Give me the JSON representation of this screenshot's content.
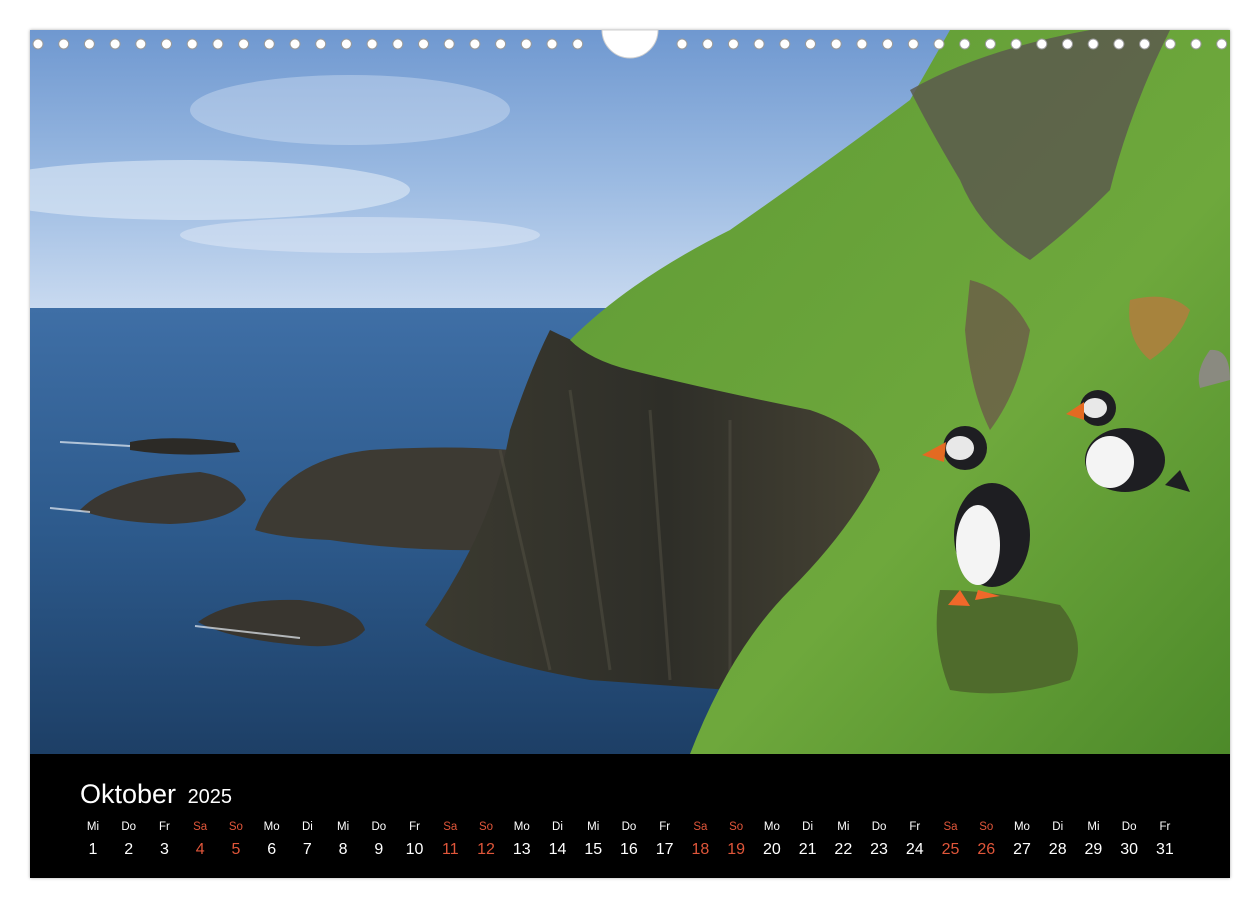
{
  "calendar": {
    "month": "Oktober",
    "year": "2025",
    "weekend_color": "#e0563a",
    "days": [
      {
        "wd": "Mi",
        "n": "1"
      },
      {
        "wd": "Do",
        "n": "2"
      },
      {
        "wd": "Fr",
        "n": "3"
      },
      {
        "wd": "Sa",
        "n": "4",
        "we": true
      },
      {
        "wd": "So",
        "n": "5",
        "we": true
      },
      {
        "wd": "Mo",
        "n": "6"
      },
      {
        "wd": "Di",
        "n": "7"
      },
      {
        "wd": "Mi",
        "n": "8"
      },
      {
        "wd": "Do",
        "n": "9"
      },
      {
        "wd": "Fr",
        "n": "10"
      },
      {
        "wd": "Sa",
        "n": "11",
        "we": true
      },
      {
        "wd": "So",
        "n": "12",
        "we": true
      },
      {
        "wd": "Mo",
        "n": "13"
      },
      {
        "wd": "Di",
        "n": "14"
      },
      {
        "wd": "Mi",
        "n": "15"
      },
      {
        "wd": "Do",
        "n": "16"
      },
      {
        "wd": "Fr",
        "n": "17"
      },
      {
        "wd": "Sa",
        "n": "18",
        "we": true
      },
      {
        "wd": "So",
        "n": "19",
        "we": true
      },
      {
        "wd": "Mo",
        "n": "20"
      },
      {
        "wd": "Di",
        "n": "21"
      },
      {
        "wd": "Mi",
        "n": "22"
      },
      {
        "wd": "Do",
        "n": "23"
      },
      {
        "wd": "Fr",
        "n": "24"
      },
      {
        "wd": "Sa",
        "n": "25",
        "we": true
      },
      {
        "wd": "So",
        "n": "26",
        "we": true
      },
      {
        "wd": "Mo",
        "n": "27"
      },
      {
        "wd": "Di",
        "n": "28"
      },
      {
        "wd": "Mi",
        "n": "29"
      },
      {
        "wd": "Do",
        "n": "30"
      },
      {
        "wd": "Fr",
        "n": "31"
      }
    ]
  }
}
